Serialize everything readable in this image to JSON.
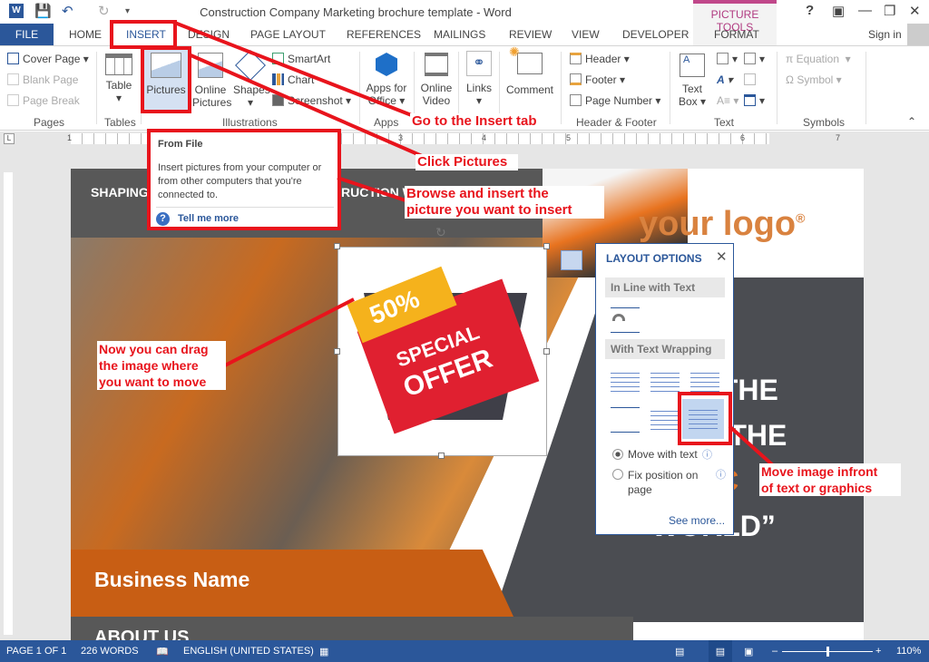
{
  "window": {
    "title": "Construction Company Marketing brochure template - Word",
    "picture_tools": "PICTURE TOOLS",
    "sign_in": "Sign in",
    "help": "?"
  },
  "tabs": [
    "FILE",
    "HOME",
    "INSERT",
    "DESIGN",
    "PAGE LAYOUT",
    "REFERENCES",
    "MAILINGS",
    "REVIEW",
    "VIEW",
    "DEVELOPER",
    "FORMAT"
  ],
  "ribbon": {
    "pages": {
      "label": "Pages",
      "items": [
        "Cover Page",
        "Blank Page",
        "Page Break"
      ]
    },
    "tables": {
      "label": "Tables",
      "table": "Table"
    },
    "illustrations": {
      "label": "Illustrations",
      "pictures": "Pictures",
      "online_pictures_1": "Online",
      "online_pictures_2": "Pictures",
      "shapes": "Shapes",
      "smartart": "SmartArt",
      "chart": "Chart",
      "screenshot": "Screenshot"
    },
    "apps": {
      "label": "Apps",
      "apps_1": "Apps for",
      "apps_2": "Office"
    },
    "media": {
      "video_1": "Online",
      "video_2": "Video"
    },
    "links": "Links",
    "comment": "Comment",
    "header_footer": {
      "label": "Header & Footer",
      "items": [
        "Header",
        "Footer",
        "Page Number"
      ]
    },
    "text": {
      "label": "Text",
      "textbox_1": "Text",
      "textbox_2": "Box"
    },
    "symbols": {
      "label": "Symbols",
      "equation": "Equation",
      "symbol": "Symbol"
    }
  },
  "ruler": [
    "1",
    "1",
    "2",
    "3",
    "4",
    "5",
    "6",
    "7"
  ],
  "tooltip": {
    "title": "From File",
    "body": "Insert pictures from your computer or from other computers that you're connected to.",
    "link": "Tell me more"
  },
  "document": {
    "header_left": "SHAPING",
    "header_right": "RUCTION W",
    "logo": "your logo",
    "logo_mark": "®",
    "headline": [
      "G THE",
      "OF THE",
      "UC",
      "WORLD”"
    ],
    "business_name": "Business Name",
    "about": "ABOUT US",
    "offer_pct": "50%",
    "offer_1": "SPECIAL",
    "offer_2": "OFFER"
  },
  "layout_options": {
    "title": "LAYOUT OPTIONS",
    "inline": "In Line with Text",
    "wrapping": "With Text Wrapping",
    "move_with_text": "Move with text",
    "fix_position": "Fix position on page",
    "see_more": "See more...",
    "selected_option": "In Front of Text",
    "move_with_text_checked": true
  },
  "annotations": {
    "insert_tab": "Go to the Insert tab",
    "click_pictures": "Click Pictures",
    "browse_1": "Browse and insert the",
    "browse_2": "picture you want to insert",
    "drag_1": "Now you can drag",
    "drag_2": "the image where",
    "drag_3": "you want to move",
    "front_1": "Move image infront",
    "front_2": "of text or graphics"
  },
  "status": {
    "page": "PAGE 1 OF 1",
    "words": "226 WORDS",
    "language": "ENGLISH (UNITED STATES)",
    "zoom": "110%",
    "zoom_percent": 110
  },
  "colors": {
    "word_blue": "#2b579a",
    "annotation_red": "#e8141c",
    "brand_orange": "#e0762a",
    "picture_tools": "#c0478a"
  }
}
